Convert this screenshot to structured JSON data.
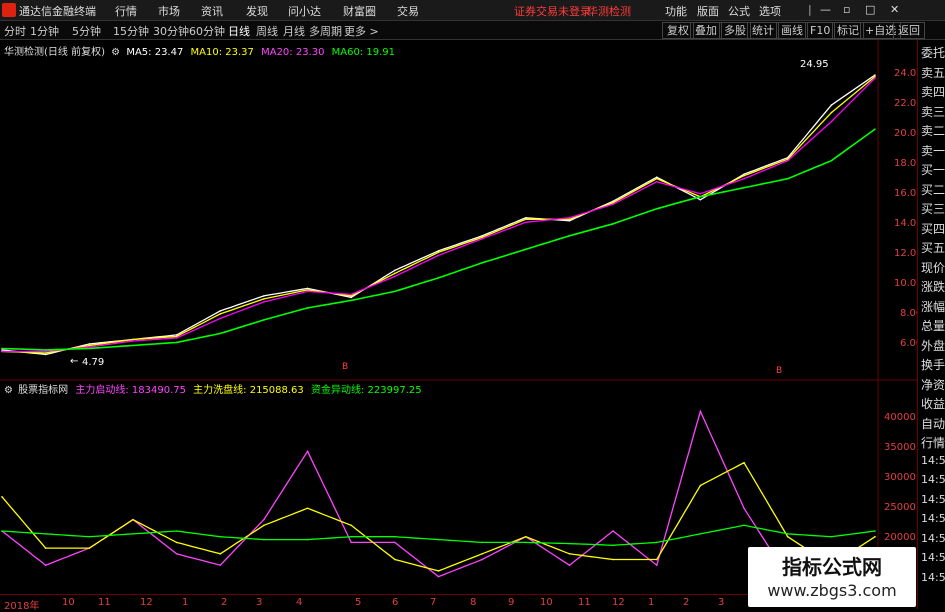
{
  "app": {
    "title": "通达信金融终端",
    "warning": "证券交易未登录",
    "warning_link": "华测检测"
  },
  "menu": {
    "items": [
      "行情",
      "市场",
      "资讯",
      "发现",
      "问小达",
      "财富圈",
      "交易"
    ],
    "right": [
      "功能",
      "版面",
      "公式",
      "选项"
    ]
  },
  "toolbar": {
    "periods": [
      "分时",
      "1分钟",
      "5分钟",
      "15分钟",
      "30分钟",
      "60分钟",
      "日线",
      "周线",
      "月线",
      "多周期",
      "更多 >"
    ],
    "active_period": "日线",
    "buttons": [
      "复权",
      "叠加",
      "多股",
      "统计",
      "画线",
      "F10",
      "标记",
      "+自选",
      "返回"
    ]
  },
  "main_chart": {
    "stock_label": "华测检测(日线 前复权)",
    "ma": [
      {
        "label": "MA5: 23.47",
        "color": "#ffffff"
      },
      {
        "label": "MA10: 23.37",
        "color": "#ffff00"
      },
      {
        "label": "MA20: 23.30",
        "color": "#ff00ff"
      },
      {
        "label": "MA60: 19.91",
        "color": "#00ff00"
      }
    ],
    "high_annotation": "24.95",
    "low_annotation": "4.79",
    "y_ticks": [
      "24.00",
      "22.00",
      "20.00",
      "18.00",
      "16.00",
      "14.00",
      "12.00",
      "10.00",
      "8.00",
      "6.00"
    ],
    "markers": [
      "B",
      "B"
    ]
  },
  "indicator": {
    "name": "股票指标网",
    "lines": [
      {
        "label": "主力启动线: 183490.75",
        "color": "#ff44ff"
      },
      {
        "label": "主力洗盘线: 215088.63",
        "color": "#ffff00"
      },
      {
        "label": "资金异动线: 223997.25",
        "color": "#00ff00"
      }
    ],
    "y_ticks": [
      "40000",
      "35000",
      "30000",
      "25000",
      "20000"
    ]
  },
  "x_axis": [
    "2018年",
    "10",
    "11",
    "12",
    "1",
    "2",
    "3",
    "4",
    "5",
    "6",
    "7",
    "8",
    "9",
    "10",
    "11",
    "12",
    "1",
    "2",
    "3",
    "4",
    "5"
  ],
  "side_panel": [
    "委托",
    "卖五",
    "卖四",
    "卖三",
    "卖二",
    "卖一",
    "买一",
    "买二",
    "买三",
    "买四",
    "买五",
    "现价",
    "涨跌",
    "涨幅",
    "总量",
    "外盘",
    "换手",
    "净资",
    "收益",
    "自动",
    "行情",
    "14:5",
    "14:5",
    "14:5",
    "14:5",
    "14:5",
    "14:5",
    "14:5"
  ],
  "watermark": {
    "line1": "指标公式网",
    "line2": "www.zbgs3.com"
  },
  "chart_data": [
    {
      "type": "line",
      "title": "华测检测(日线 前复权)",
      "ylim": [
        4.0,
        25.5
      ],
      "x": [
        "2018年",
        "10",
        "11",
        "12",
        "1",
        "2",
        "3",
        "4",
        "5",
        "6",
        "7",
        "8",
        "9",
        "10",
        "11",
        "12",
        "1",
        "2",
        "3",
        "4",
        "5"
      ],
      "series": [
        {
          "name": "MA5",
          "color": "#ffffff",
          "values": [
            5.2,
            4.9,
            5.6,
            5.9,
            6.2,
            7.8,
            8.8,
            9.3,
            8.7,
            10.5,
            11.8,
            12.8,
            14.0,
            13.8,
            15.1,
            16.7,
            15.2,
            16.9,
            18.0,
            21.5,
            23.5
          ]
        },
        {
          "name": "MA10",
          "color": "#ffff00",
          "values": [
            5.1,
            5.0,
            5.5,
            5.9,
            6.1,
            7.6,
            8.6,
            9.2,
            8.8,
            10.3,
            11.7,
            12.7,
            13.9,
            13.9,
            15.0,
            16.6,
            15.4,
            16.8,
            17.9,
            21.0,
            23.4
          ]
        },
        {
          "name": "MA20",
          "color": "#ff00ff",
          "values": [
            5.1,
            5.1,
            5.4,
            5.8,
            6.0,
            7.3,
            8.4,
            9.1,
            8.9,
            10.1,
            11.5,
            12.6,
            13.7,
            14.0,
            14.9,
            16.4,
            15.6,
            16.6,
            17.8,
            20.4,
            23.3
          ]
        },
        {
          "name": "MA60",
          "color": "#00ff00",
          "values": [
            5.3,
            5.2,
            5.3,
            5.5,
            5.7,
            6.3,
            7.2,
            8.0,
            8.5,
            9.1,
            10.0,
            11.0,
            11.9,
            12.8,
            13.6,
            14.6,
            15.4,
            16.0,
            16.6,
            17.8,
            19.9
          ]
        }
      ]
    },
    {
      "type": "line",
      "title": "股票指标网",
      "ylim": [
        12000,
        45000
      ],
      "x": [
        "2018年",
        "10",
        "11",
        "12",
        "1",
        "2",
        "3",
        "4",
        "5",
        "6",
        "7",
        "8",
        "9",
        "10",
        "11",
        "12",
        "1",
        "2",
        "3",
        "4",
        "5"
      ],
      "series": [
        {
          "name": "主力启动线",
          "color": "#ff44ff",
          "values": [
            22000,
            16000,
            19000,
            24000,
            18000,
            16000,
            24000,
            36000,
            20000,
            20000,
            14000,
            17000,
            21000,
            16000,
            22000,
            16000,
            43000,
            26000,
            14000,
            15000,
            18000
          ]
        },
        {
          "name": "主力洗盘线",
          "color": "#ffff00",
          "values": [
            28000,
            19000,
            19000,
            24000,
            20000,
            18000,
            23000,
            26000,
            23000,
            17000,
            15000,
            18000,
            21000,
            18000,
            17000,
            17000,
            30000,
            34000,
            21000,
            16000,
            21000
          ]
        },
        {
          "name": "资金异动线",
          "color": "#00ff00",
          "values": [
            22000,
            21500,
            21000,
            21500,
            22000,
            21000,
            20500,
            20500,
            21000,
            21000,
            20500,
            20000,
            20000,
            19800,
            19500,
            20000,
            21500,
            23000,
            21500,
            21000,
            22000
          ]
        }
      ]
    }
  ]
}
